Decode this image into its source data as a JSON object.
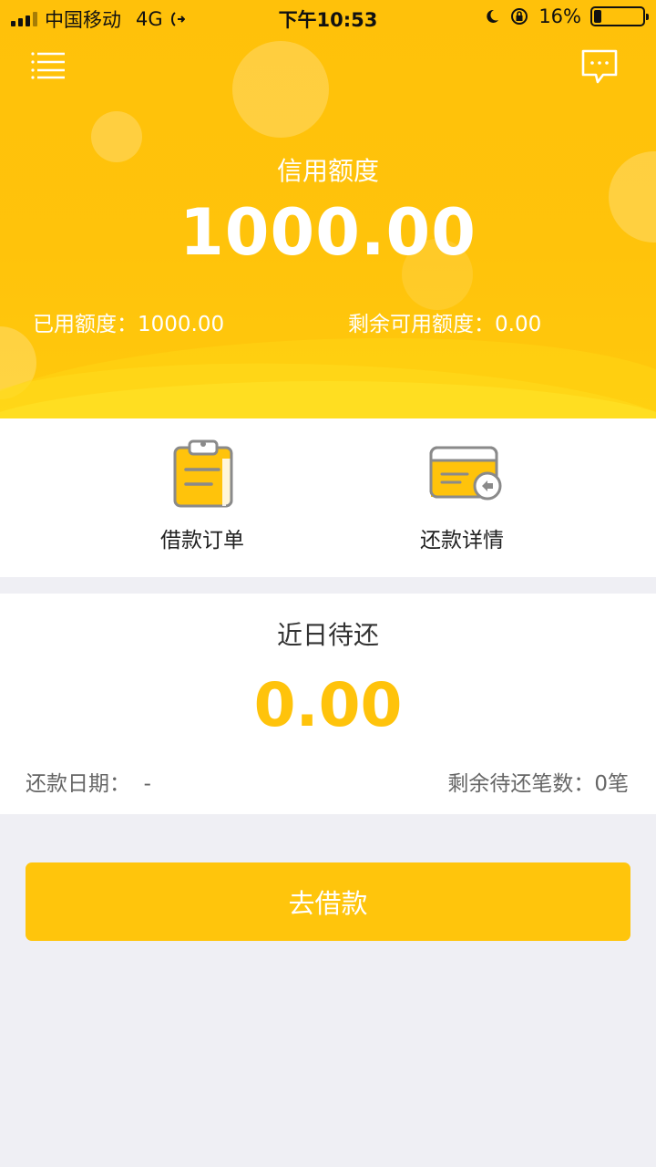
{
  "status_bar": {
    "carrier": "中国移动",
    "network": "4G",
    "time": "下午10:53",
    "battery_percent": "16%",
    "battery_level": 0.16
  },
  "header": {
    "credit_label": "信用额度",
    "credit_amount": "1000.00",
    "used_text": "已用额度：1000.00",
    "remaining_text": "剩余可用额度：0.00",
    "menu_icon": "menu-list-icon",
    "message_icon": "message-icon"
  },
  "actions": [
    {
      "label": "借款订单",
      "icon": "clipboard-order-icon"
    },
    {
      "label": "还款详情",
      "icon": "card-repay-icon"
    }
  ],
  "recent_due": {
    "title": "近日待还",
    "amount": "0.00",
    "date_text": "还款日期：  -",
    "count_text": "剩余待还笔数：0笔"
  },
  "cta": {
    "label": "去借款"
  },
  "colors": {
    "brand_yellow": "#ffc30b",
    "page_bg": "#efeff4",
    "text_dark": "#222222",
    "text_muted": "#666666"
  }
}
